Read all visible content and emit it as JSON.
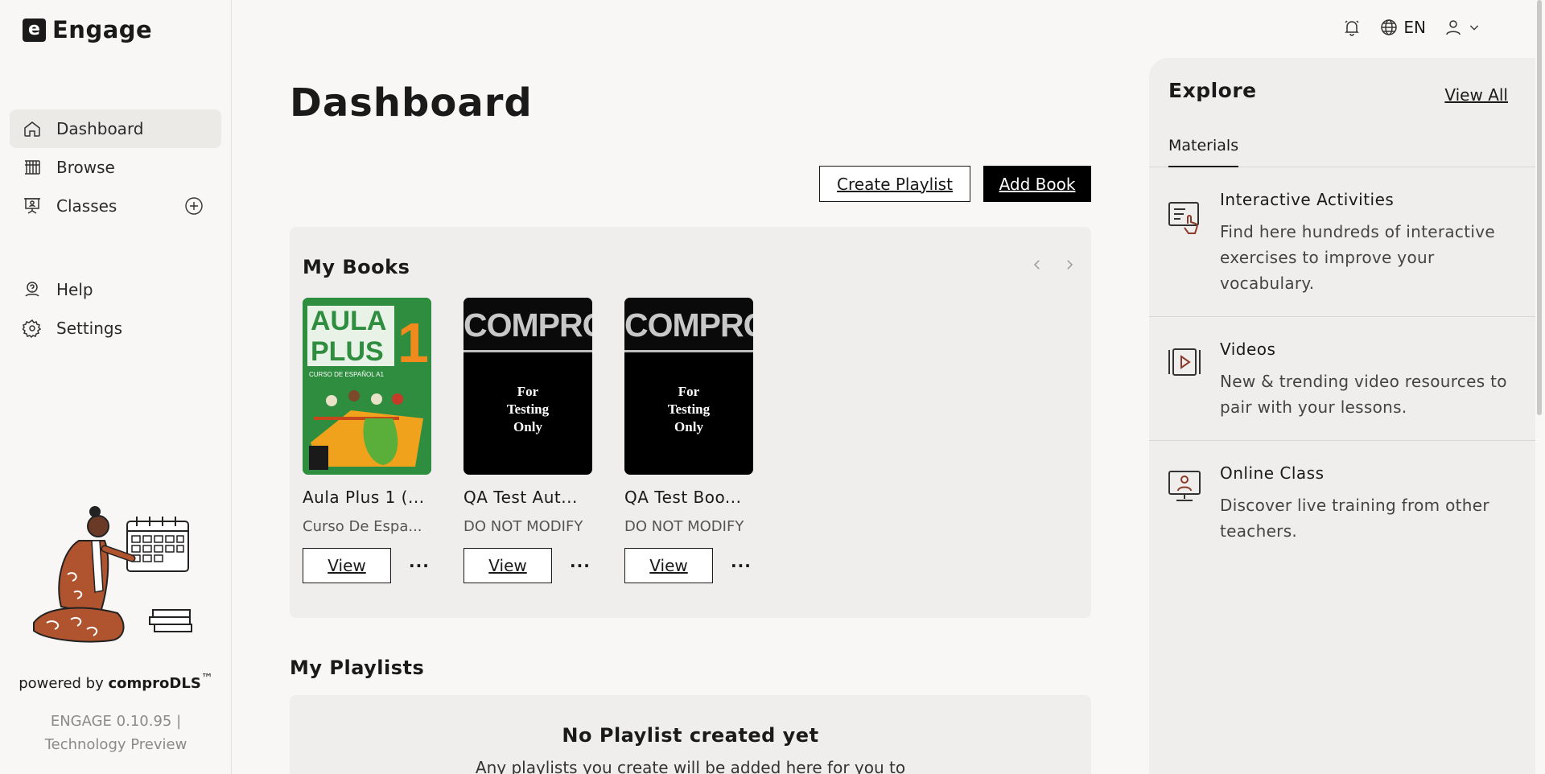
{
  "app": {
    "logo_letter": "e",
    "name": "Engage"
  },
  "sidebar": {
    "items": [
      {
        "label": "Dashboard",
        "icon": "home-icon",
        "active": true
      },
      {
        "label": "Browse",
        "icon": "library-icon"
      },
      {
        "label": "Classes",
        "icon": "classroom-icon"
      },
      {
        "label": "Help",
        "icon": "help-icon"
      },
      {
        "label": "Settings",
        "icon": "gear-icon"
      }
    ],
    "powered_by_prefix": "powered by ",
    "powered_by_brand": "comproDLS",
    "trademark": "™",
    "version": "ENGAGE 0.10.95 |",
    "version_note": "Technology Preview"
  },
  "topbar": {
    "language": "EN",
    "icons": [
      "notification-bell-icon",
      "globe-icon",
      "user-icon",
      "chevron-down-icon"
    ]
  },
  "main": {
    "title": "Dashboard",
    "create_playlist": "Create Playlist",
    "add_book": "Add Book",
    "my_books": {
      "title": "My Books",
      "books": [
        {
          "title": "Aula Plus 1 (...",
          "subtitle": "Curso De Espa...",
          "view": "View",
          "more": "···",
          "cover": "aula"
        },
        {
          "title": "QA Test Aut...",
          "subtitle": "DO NOT MODIFY",
          "view": "View",
          "more": "···",
          "cover": "compro"
        },
        {
          "title": "QA Test Boo...",
          "subtitle": "DO NOT MODIFY",
          "view": "View",
          "more": "···",
          "cover": "compro"
        }
      ]
    },
    "cover_compro": {
      "brand": "COMPRO",
      "line1": "For",
      "line2": "Testing",
      "line3": "Only"
    },
    "cover_aula": {
      "word1": "AULA",
      "word2": "PLUS",
      "number": "1",
      "tagline": "CURSO DE ESPAÑOL A1"
    },
    "my_playlists": {
      "title": "My Playlists",
      "empty_title": "No Playlist created yet",
      "empty_text": "Any playlists you create will be added here for you to"
    }
  },
  "explore": {
    "title": "Explore",
    "view_all": "View All",
    "tab": "Materials",
    "items": [
      {
        "title": "Interactive Activities",
        "description": "Find here hundreds of interactive exercises to improve your vocabulary.",
        "icon": "interactive-activity-icon"
      },
      {
        "title": "Videos",
        "description": "New & trending video resources to pair with your lessons.",
        "icon": "video-icon"
      },
      {
        "title": "Online Class",
        "description": "Discover live training from other teachers.",
        "icon": "online-class-icon"
      }
    ]
  },
  "colors": {
    "background": "#f8f7f5",
    "panel": "#efeeec",
    "accent": "#000000",
    "icon_brown": "#8b3a2b"
  }
}
